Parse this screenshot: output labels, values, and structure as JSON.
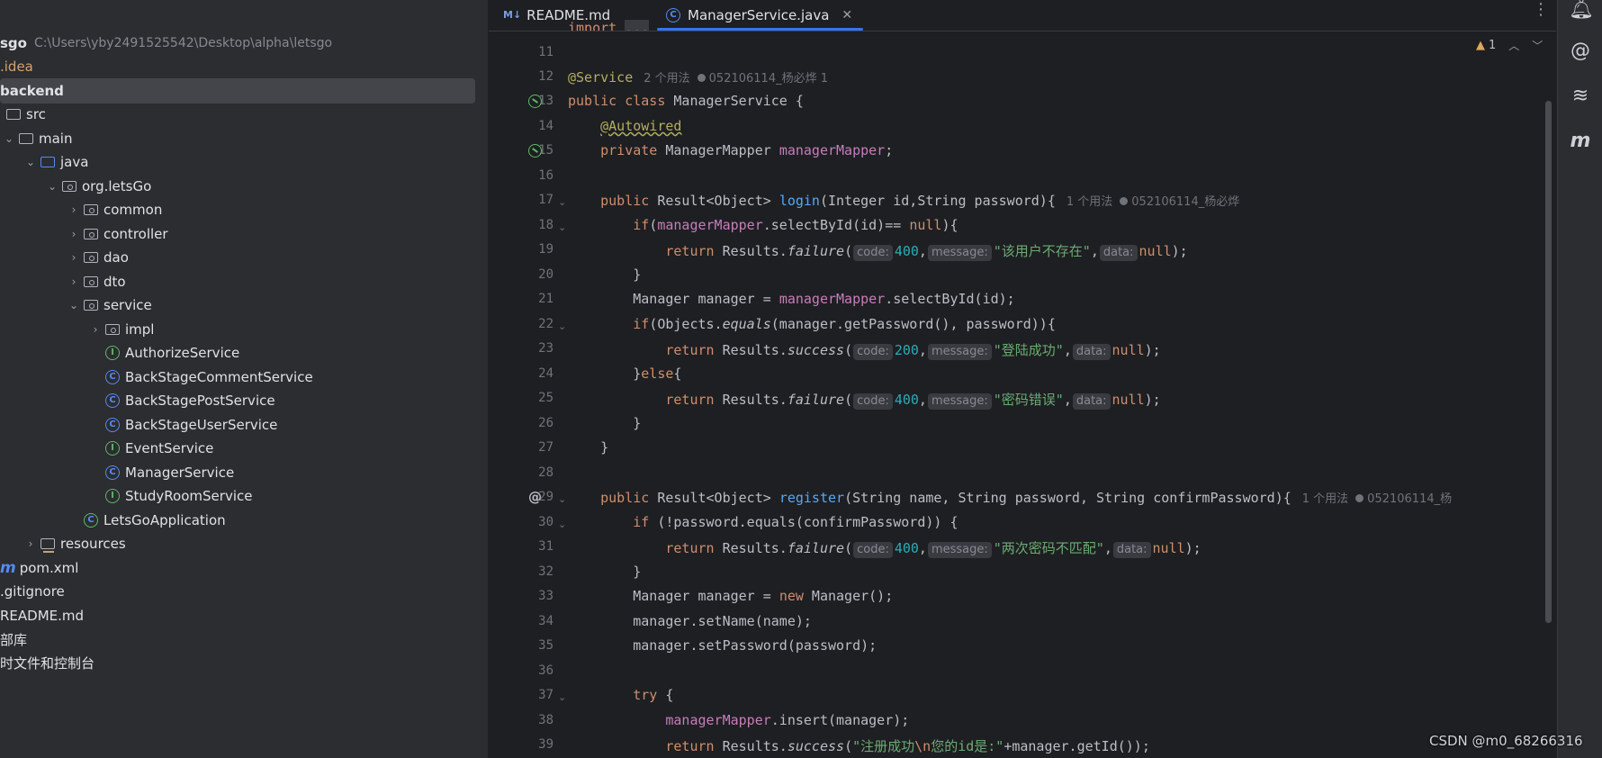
{
  "project_tree": {
    "root": {
      "name": "sgo",
      "path": "C:\\Users\\yby2491525542\\Desktop\\alpha\\letsgo"
    },
    "items": [
      {
        "label": ".idea"
      },
      {
        "label": "backend"
      },
      {
        "label": "src"
      },
      {
        "label": "main"
      },
      {
        "label": "java"
      },
      {
        "label": "org.letsGo"
      },
      {
        "label": "common"
      },
      {
        "label": "controller"
      },
      {
        "label": "dao"
      },
      {
        "label": "dto"
      },
      {
        "label": "service"
      },
      {
        "label": "impl"
      },
      {
        "label": "AuthorizeService"
      },
      {
        "label": "BackStageCommentService"
      },
      {
        "label": "BackStagePostService"
      },
      {
        "label": "BackStageUserService"
      },
      {
        "label": "EventService"
      },
      {
        "label": "ManagerService"
      },
      {
        "label": "StudyRoomService"
      },
      {
        "label": "LetsGoApplication"
      },
      {
        "label": "resources"
      },
      {
        "label": "pom.xml"
      },
      {
        "label": ".gitignore"
      },
      {
        "label": "README.md"
      },
      {
        "label": "部库"
      },
      {
        "label": "时文件和控制台"
      }
    ]
  },
  "tabs": [
    {
      "label": "README.md",
      "icon": "markdown-icon"
    },
    {
      "label": "ManagerService.java",
      "icon": "class-icon"
    }
  ],
  "editor": {
    "warnings": "1",
    "hints": {
      "usages_2": "2 个用法",
      "usages_1": "1 个用法",
      "author_1": "052106114_杨必烨 1",
      "author": "052106114_杨必烨",
      "author_cut": "052106114_杨",
      "code": "code:",
      "message": "message:",
      "data": "data:"
    },
    "strings": {
      "user_missing": "\"该用户不存在\"",
      "login_ok": "\"登陆成功\"",
      "pwd_wrong": "\"密码错误\"",
      "pwd_mismatch": "\"两次密码不匹配\"",
      "reg_ok_a": "\"注册成功",
      "reg_ok_esc": "\\n",
      "reg_ok_b": "您的id是:\""
    },
    "line_numbers": [
      "11",
      "12",
      "13",
      "14",
      "15",
      "16",
      "17",
      "18",
      "19",
      "20",
      "21",
      "22",
      "23",
      "24",
      "25",
      "26",
      "27",
      "28",
      "29",
      "30",
      "31",
      "32",
      "33",
      "34",
      "35",
      "36",
      "37",
      "38",
      "39"
    ]
  },
  "watermark": "CSDN @m0_68266316",
  "colors": {
    "accent": "#3574f0",
    "keyword": "#cf8e6d",
    "string": "#6aab73",
    "number": "#2aacb8",
    "field": "#c77dbb",
    "function": "#56a8f5"
  }
}
